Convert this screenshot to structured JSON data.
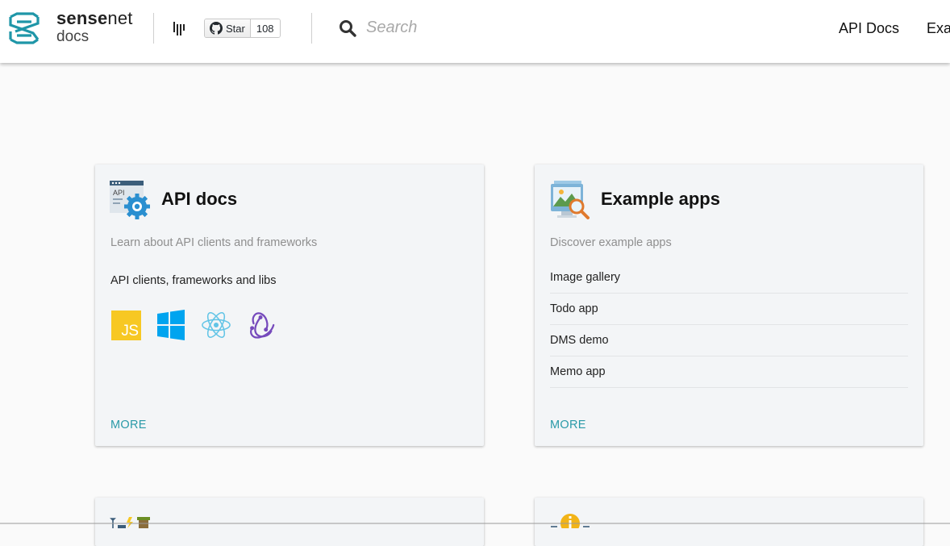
{
  "header": {
    "brand_name_bold": "sense",
    "brand_name_rest": "net",
    "brand_sub": "docs",
    "github": {
      "star_label": "Star",
      "star_count": "108"
    },
    "search": {
      "placeholder": "Search"
    },
    "nav": [
      {
        "label": "API Docs"
      },
      {
        "label": "Exa"
      }
    ]
  },
  "cards": [
    {
      "icon": "api-settings-icon",
      "title": "API docs",
      "description": "Learn about API clients and frameworks",
      "subtitle": "API clients, frameworks and libs",
      "libs": [
        {
          "icon": "javascript-icon",
          "text": "JS"
        },
        {
          "icon": "windows-icon"
        },
        {
          "icon": "react-icon"
        },
        {
          "icon": "redux-icon"
        }
      ],
      "more_label": "MORE"
    },
    {
      "icon": "example-apps-icon",
      "title": "Example apps",
      "description": "Discover example apps",
      "items": [
        "Image gallery",
        "Todo app",
        "DMS demo",
        "Memo app"
      ],
      "more_label": "MORE"
    }
  ],
  "colors": {
    "accent": "#2a9aa8",
    "logo": "#1f96a8",
    "card_bg": "#f3f5f7",
    "page_bg": "#fafafa"
  }
}
